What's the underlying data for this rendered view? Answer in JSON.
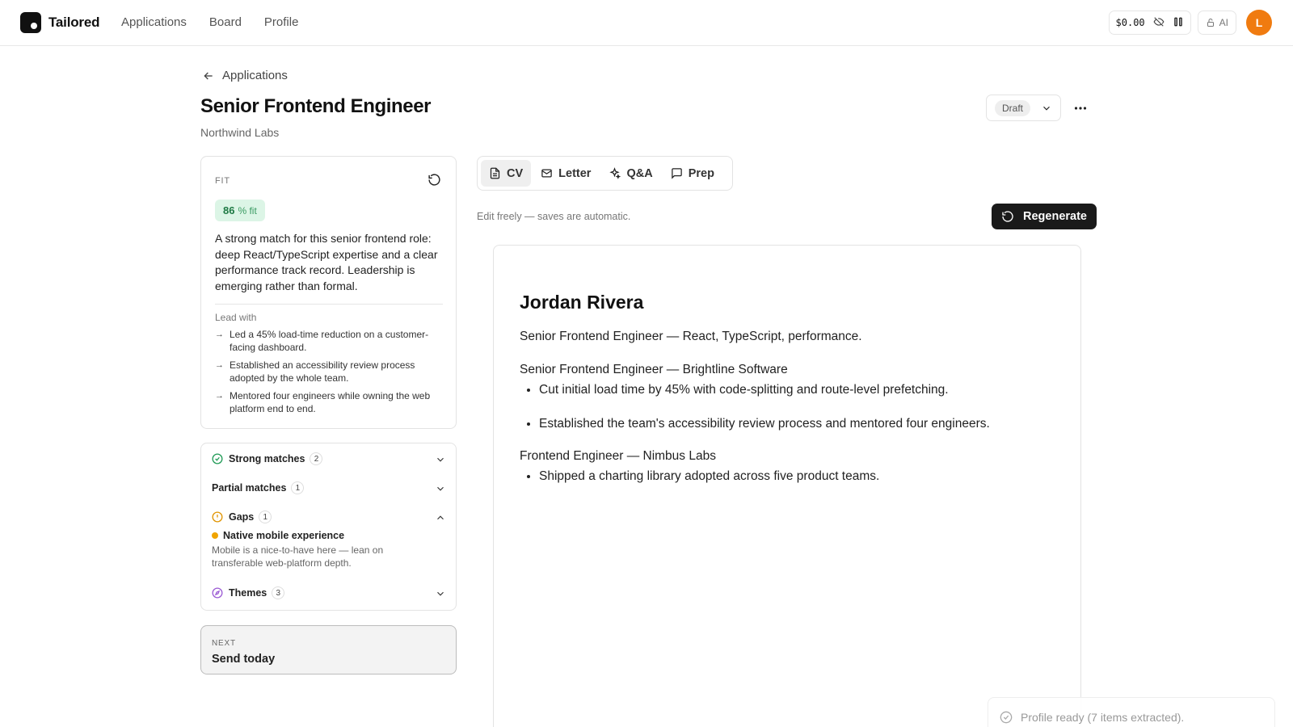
{
  "app": {
    "name": "Tailored",
    "nav": [
      "Applications",
      "Board",
      "Profile"
    ],
    "cost": "$0.00",
    "ai_label": "AI",
    "avatar_initial": "L",
    "accent": "#f07b10"
  },
  "header": {
    "back_label": "Applications",
    "title": "Senior Frontend Engineer",
    "company": "Northwind Labs",
    "status": "Draft"
  },
  "fit": {
    "label": "FIT",
    "score": "86",
    "unit": "% fit",
    "summary": "A strong match for this senior frontend role: deep React/TypeScript expertise and a clear performance track record. Leadership is emerging rather than formal.",
    "lead_label": "Lead with",
    "lead_items": [
      "Led a 45% load-time reduction on a customer-facing dashboard.",
      "Established an accessibility review process adopted by the whole team.",
      "Mentored four engineers while owning the web platform end to end."
    ]
  },
  "matches": {
    "strong": {
      "label": "Strong matches",
      "count": "2"
    },
    "partial": {
      "label": "Partial matches",
      "count": "1"
    },
    "gaps": {
      "label": "Gaps",
      "count": "1",
      "item_title": "Native mobile experience",
      "item_desc": "Mobile is a nice-to-have here — lean on transferable web-platform depth."
    },
    "themes": {
      "label": "Themes",
      "count": "3"
    }
  },
  "next": {
    "label": "NEXT",
    "text": "Send today"
  },
  "tabs": [
    "CV",
    "Letter",
    "Q&A",
    "Prep"
  ],
  "editor": {
    "hint": "Edit freely — saves are automatic.",
    "regenerate_label": "Regenerate"
  },
  "cv": {
    "name": "Jordan Rivera",
    "headline": "Senior Frontend Engineer — React, TypeScript, performance.",
    "jobs": [
      {
        "title": "Senior Frontend Engineer — Brightline Software",
        "bullets": [
          "Cut initial load time by 45% with code-splitting and route-level prefetching.",
          "Established the team's accessibility review process and mentored four engineers."
        ]
      },
      {
        "title": "Frontend Engineer — Nimbus Labs",
        "bullets": [
          "Shipped a charting library adopted across five product teams."
        ]
      }
    ]
  },
  "toast": {
    "text": "Profile ready (7 items extracted)."
  }
}
